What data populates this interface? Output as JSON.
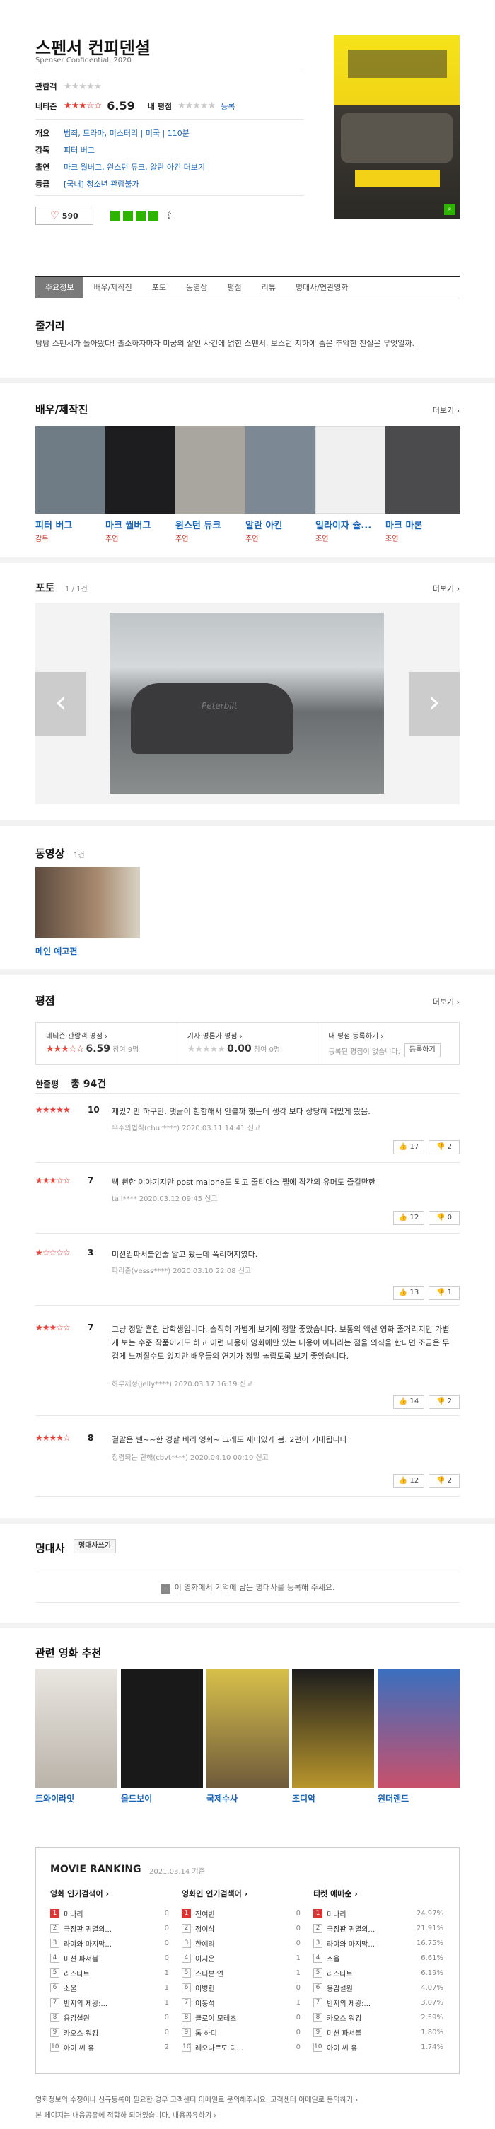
{
  "movie": {
    "title": "스펜서 컨피덴셜",
    "subtitle": "Spenser Confidential, 2020"
  },
  "ratings": {
    "audience_label": "관람객",
    "netizen_label": "네티즌",
    "netizen_score": "6.59",
    "my_label": "내 평점",
    "register": "등록"
  },
  "info": [
    {
      "label": "개요",
      "value": "범죄, 드라마, 미스터리 | 미국 | 110분"
    },
    {
      "label": "감독",
      "value": "피터 버그"
    },
    {
      "label": "출연",
      "value": "마크 월버그, 윈스턴 듀크, 알란 아킨 더보기"
    },
    {
      "label": "등급",
      "value": "[국내] 청소년 관람불가"
    }
  ],
  "like_count": "590",
  "tabs": [
    "주요정보",
    "배우/제작진",
    "포토",
    "동영상",
    "평점",
    "리뷰",
    "명대사/연관영화"
  ],
  "synopsis": {
    "heading": "줄거리",
    "text": "탕탕 스펜서가 돌아왔다! 출소하자마자 미궁의 살인 사건에 얽힌 스펜서. 보스턴 지하에 숨은 추악한 진실은 무엇일까."
  },
  "cast_section": {
    "heading": "배우/제작진",
    "more": "더보기 ›"
  },
  "cast": [
    {
      "name": "피터 버그",
      "role": "감독"
    },
    {
      "name": "마크 월버그",
      "role": "주연"
    },
    {
      "name": "윈스턴 듀크",
      "role": "주연"
    },
    {
      "name": "알란 아킨",
      "role": "주연"
    },
    {
      "name": "일라이자 슐...",
      "role": "조연"
    },
    {
      "name": "마크 마론",
      "role": "조연"
    }
  ],
  "photo": {
    "heading": "포토",
    "count": "1 / 1건",
    "more": "더보기 ›",
    "plate": "Peterbilt"
  },
  "video": {
    "heading": "동영상",
    "count": "1건",
    "label": "메인 예고편"
  },
  "rating_section": {
    "heading": "평점",
    "more": "더보기 ›",
    "boxes": [
      {
        "title": "네티즌·관람객 평점 ›",
        "score": "6.59",
        "sub": "참여 9명"
      },
      {
        "title": "기자·평론가 평점 ›",
        "score": "0.00",
        "sub": "참여 0명"
      },
      {
        "title": "내 평점 등록하기 ›",
        "score": "",
        "sub": "등록된 평점이 없습니다.",
        "button": "등록하기"
      }
    ],
    "summary_label": "한줄평",
    "summary_count": "총 94건"
  },
  "reviews": [
    {
      "stars": "★★★★★",
      "score": "10",
      "text": "재밌기만 하구만. 댓글이 험함해서 안볼까 했는데 생각 보다 상당히 재밌게 봤음.",
      "meta": "우주의법칙(chur****)  2020.03.11 14:41  신고",
      "up": "17",
      "down": "2"
    },
    {
      "stars": "★★★☆☆",
      "score": "7",
      "text": "뻑 뻔한 이야기지만 post malone도 되고 줄티아스 펠에 작간의 유머도 즐길만한",
      "meta": "tall****  2020.03.12 09:45  신고",
      "up": "12",
      "down": "0"
    },
    {
      "stars": "★☆☆☆☆",
      "score": "3",
      "text": "미션임파서블인줄 알고 봤는데 폭리허지였다.",
      "meta": "파리존(vesss****)  2020.03.10 22:08  신고",
      "up": "13",
      "down": "1"
    },
    {
      "stars": "★★★☆☆",
      "score": "7",
      "text": "그냥 정말 흔한 남학생입니다. 솔직히 가볍게 보기에 정말 좋았습니다. 보통의 액션 영화 줄거리지만 가볍게 보는 수준 작품이기도 하고 이런 내용이 영화에만 있는 내용이 아니라는 점을 의식을 한다면 조금은 무겁게 느껴질수도 있지만 배우들의 연기가 정말 놀랍도록 보기 좋았습니다.",
      "meta": "하루제정(jelly****)  2020.03.17 16:19  신고",
      "up": "14",
      "down": "2"
    },
    {
      "stars": "★★★★☆",
      "score": "8",
      "text": "결말은 쎈~~한 경찰 비리 영화~ 그래도 재미있게 봄. 2편이 기대됩니다",
      "meta": "청렴되는 한해(cbvt****)  2020.04.10 00:10  신고",
      "up": "12",
      "down": "2"
    }
  ],
  "quote": {
    "heading": "명대사",
    "button": "명대사쓰기",
    "empty": "이 영화에서 기억에 남는 명대사를 등록해 주세요."
  },
  "recommend": {
    "heading": "관련 영화 추천",
    "items": [
      "트와이라잇",
      "올드보이",
      "국제수사",
      "조디악",
      "원더랜드"
    ]
  },
  "ranking": {
    "title": "MOVIE RANKING",
    "date": "2021.03.14 기준",
    "cols": [
      {
        "title": "영화 인기검색어 ›",
        "items": [
          [
            "미나리",
            "0"
          ],
          [
            "극장판 귀멸의...",
            "0"
          ],
          [
            "라야와 마지막...",
            "0"
          ],
          [
            "미션 파서블",
            "0"
          ],
          [
            "리스타트",
            "1"
          ],
          [
            "소울",
            "1"
          ],
          [
            "반지의 제왕:...",
            "1"
          ],
          [
            "용감설원",
            "0"
          ],
          [
            "카오스 워킹",
            "0"
          ],
          [
            "아이 씨 유",
            "2"
          ]
        ]
      },
      {
        "title": "영화인 인기검색어 ›",
        "items": [
          [
            "전여빈",
            "0"
          ],
          [
            "정이삭",
            "0"
          ],
          [
            "한예리",
            "0"
          ],
          [
            "이지은",
            "1"
          ],
          [
            "스티븐 연",
            "1"
          ],
          [
            "이병헌",
            "0"
          ],
          [
            "이동석",
            "1"
          ],
          [
            "클로이 모레츠",
            "0"
          ],
          [
            "톰 하디",
            "0"
          ],
          [
            "레오나르도 디...",
            "0"
          ]
        ]
      },
      {
        "title": "티켓 예매순 ›",
        "items": [
          [
            "미나리",
            "24.97%"
          ],
          [
            "극장판 귀멸의...",
            "21.91%"
          ],
          [
            "라야와 마지막...",
            "16.75%"
          ],
          [
            "소울",
            "6.61%"
          ],
          [
            "리스타트",
            "6.19%"
          ],
          [
            "용감설원",
            "4.07%"
          ],
          [
            "반지의 제왕:...",
            "3.07%"
          ],
          [
            "카오스 워킹",
            "2.59%"
          ],
          [
            "미션 파서블",
            "1.80%"
          ],
          [
            "아이 씨 유",
            "1.74%"
          ]
        ]
      }
    ]
  },
  "footer": {
    "line1": "영화정보의 수정이나 신규등록이 필요한 경우 고객센터 이메일로 문의해주세요.  고객센터 이메일로 문의하기 ›",
    "line2": "본 페이지는 내용공유에 적합하 되어있습니다.  내용공유하기 ›"
  },
  "colors": {
    "accent": "#e8433a",
    "link": "#1a63b5",
    "tab_active": "#7a7a7a"
  }
}
